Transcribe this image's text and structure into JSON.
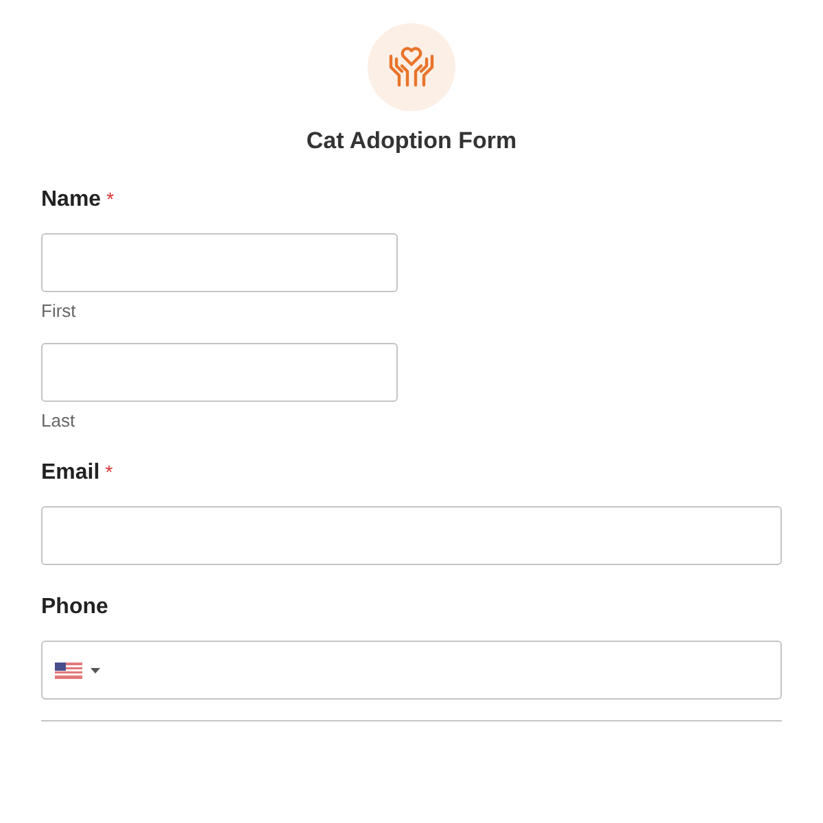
{
  "title": "Cat Adoption Form",
  "required_mark": "*",
  "fields": [
    {
      "kind": "name",
      "label": "Name",
      "required": true,
      "sublabels": [
        "First",
        "Last"
      ]
    },
    {
      "kind": "text",
      "label": "Email",
      "required": true
    },
    {
      "kind": "phone",
      "label": "Phone",
      "required": false
    }
  ]
}
